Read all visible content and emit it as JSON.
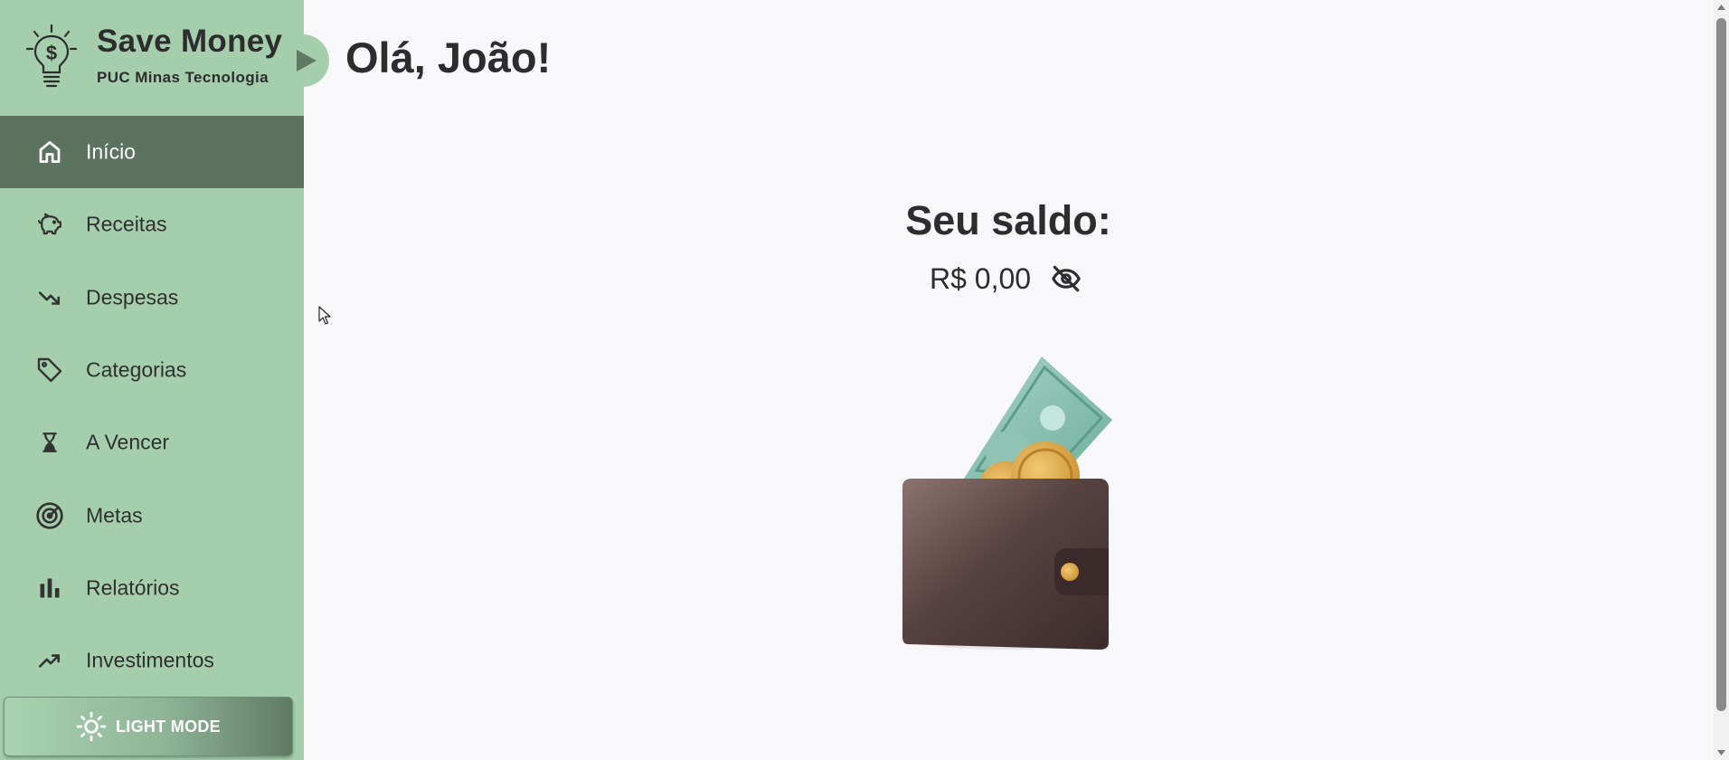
{
  "brand": {
    "name": "Save Money",
    "subtitle": "PUC Minas Tecnologia",
    "logo_icon": "lightbulb-dollar-icon"
  },
  "sidebar": {
    "items": [
      {
        "label": "Início",
        "icon": "home-icon",
        "active": true
      },
      {
        "label": "Receitas",
        "icon": "piggy-bank-icon",
        "active": false
      },
      {
        "label": "Despesas",
        "icon": "trending-down-icon",
        "active": false
      },
      {
        "label": "Categorias",
        "icon": "tag-icon",
        "active": false
      },
      {
        "label": "A Vencer",
        "icon": "hourglass-icon",
        "active": false
      },
      {
        "label": "Metas",
        "icon": "target-icon",
        "active": false
      },
      {
        "label": "Relatórios",
        "icon": "bar-chart-icon",
        "active": false
      },
      {
        "label": "Investimentos",
        "icon": "trending-up-icon",
        "active": false
      }
    ],
    "mode_button": {
      "label": "LIGHT MODE",
      "icon": "sun-icon"
    }
  },
  "main": {
    "greeting": "Olá, João!",
    "balance_title": "Seu saldo:",
    "balance_value": "R$ 0,00",
    "visibility_icon": "eye-off-icon",
    "illustration": "wallet-with-money-illustration"
  },
  "colors": {
    "sidebar_bg": "#a5cfac",
    "active_item_bg": "#5b735f",
    "page_bg": "#f8f8fb",
    "text": "#2d2d2d"
  }
}
